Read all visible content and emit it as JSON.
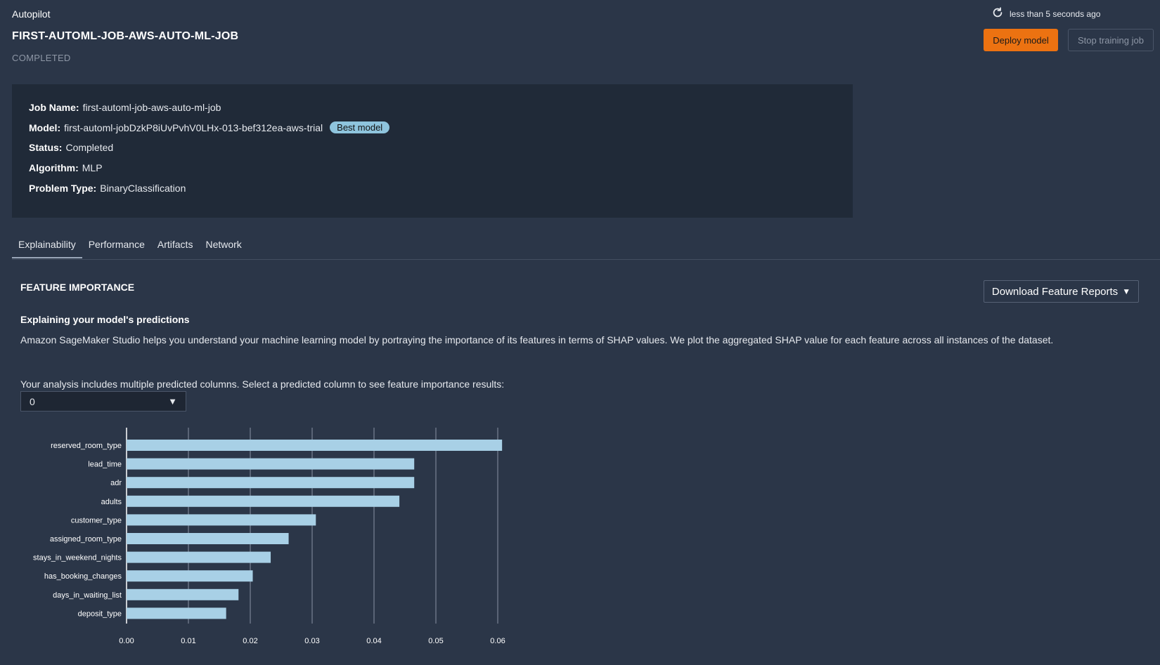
{
  "header": {
    "app_title": "Autopilot",
    "job_title": "FIRST-AUTOML-JOB-AWS-AUTO-ML-JOB",
    "job_status": "COMPLETED",
    "refresh_text": "less than 5 seconds ago",
    "deploy_label": "Deploy model",
    "stop_label": "Stop training job"
  },
  "info": {
    "job_name_label": "Job Name:",
    "job_name_value": "first-automl-job-aws-auto-ml-job",
    "model_label": "Model:",
    "model_value": "first-automl-jobDzkP8iUvPvhV0LHx-013-bef312ea-aws-trial",
    "best_model_badge": "Best model",
    "status_label": "Status:",
    "status_value": "Completed",
    "algorithm_label": "Algorithm:",
    "algorithm_value": "MLP",
    "problem_type_label": "Problem Type:",
    "problem_type_value": "BinaryClassification"
  },
  "tabs": [
    {
      "label": "Explainability",
      "active": true
    },
    {
      "label": "Performance",
      "active": false
    },
    {
      "label": "Artifacts",
      "active": false
    },
    {
      "label": "Network",
      "active": false
    }
  ],
  "explainability": {
    "section_title": "FEATURE IMPORTANCE",
    "download_label": "Download Feature Reports",
    "subheading": "Explaining your model's predictions",
    "description": "Amazon SageMaker Studio helps you understand your machine learning model by portraying the importance of its features in terms of SHAP values. We plot the aggregated SHAP value for each feature across all instances of the dataset.",
    "select_label": "Your analysis includes multiple predicted columns. Select a predicted column to see feature importance results:",
    "select_value": "0"
  },
  "colors": {
    "accent": "#ec7211",
    "bar": "#a8d0e6",
    "background": "#2b3648",
    "panel": "#202a38"
  },
  "chart_data": {
    "type": "bar",
    "orientation": "horizontal",
    "categories": [
      "reserved_room_type",
      "lead_time",
      "adr",
      "adults",
      "customer_type",
      "assigned_room_type",
      "stays_in_weekend_nights",
      "has_booking_changes",
      "days_in_waiting_list",
      "deposit_type"
    ],
    "values": [
      0.0607,
      0.0465,
      0.0465,
      0.0441,
      0.0306,
      0.0262,
      0.0233,
      0.0204,
      0.0181,
      0.0161
    ],
    "xlim": [
      0,
      0.06
    ],
    "xticks": [
      "0.00",
      "0.01",
      "0.02",
      "0.03",
      "0.04",
      "0.05",
      "0.06"
    ],
    "grid": true,
    "title": "",
    "xlabel": "",
    "ylabel": ""
  }
}
